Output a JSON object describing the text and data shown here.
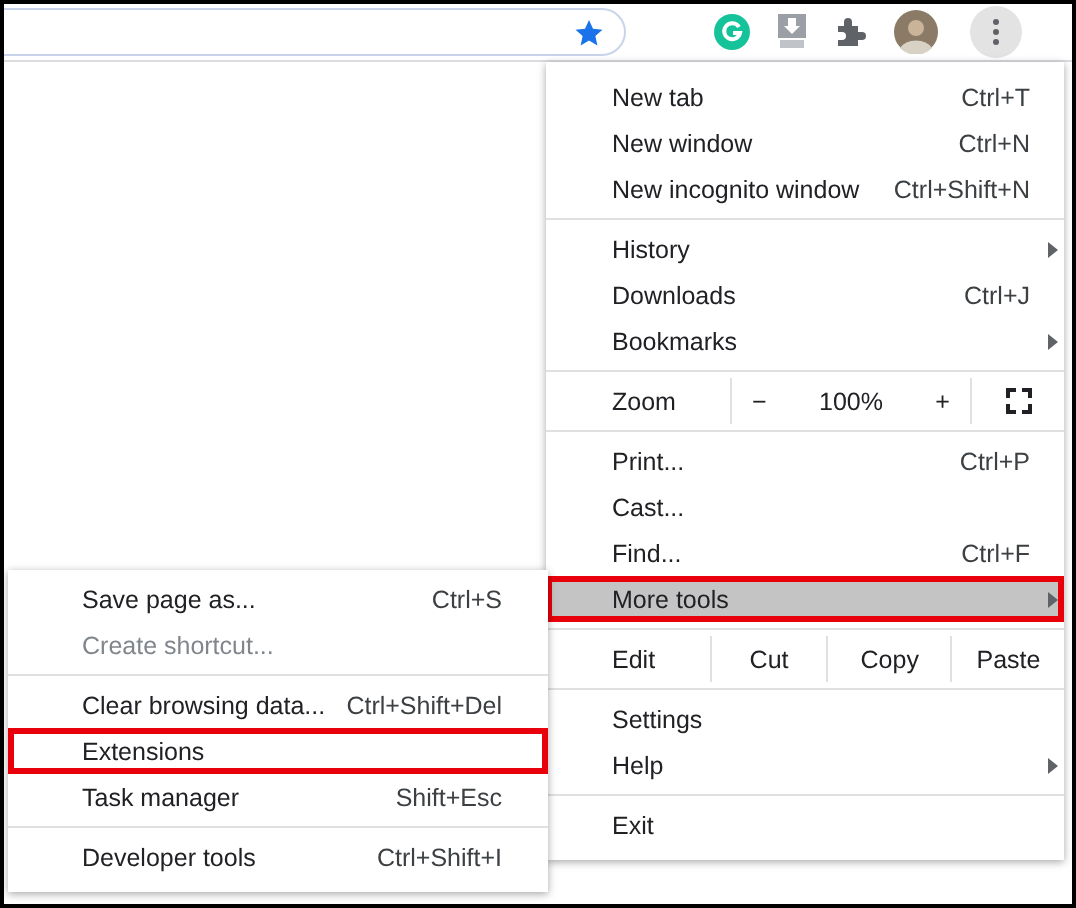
{
  "menu": {
    "items": [
      {
        "kind": "item",
        "label": "New tab",
        "shortcut": "Ctrl+T"
      },
      {
        "kind": "item",
        "label": "New window",
        "shortcut": "Ctrl+N"
      },
      {
        "kind": "item",
        "label": "New incognito window",
        "shortcut": "Ctrl+Shift+N"
      },
      {
        "kind": "separator"
      },
      {
        "kind": "item",
        "label": "History",
        "has_submenu": true
      },
      {
        "kind": "item",
        "label": "Downloads",
        "shortcut": "Ctrl+J"
      },
      {
        "kind": "item",
        "label": "Bookmarks",
        "has_submenu": true
      },
      {
        "kind": "separator"
      },
      {
        "kind": "zoom",
        "label": "Zoom",
        "minus": "−",
        "value": "100%",
        "plus": "+"
      },
      {
        "kind": "separator"
      },
      {
        "kind": "item",
        "label": "Print...",
        "shortcut": "Ctrl+P"
      },
      {
        "kind": "item",
        "label": "Cast..."
      },
      {
        "kind": "item",
        "label": "Find...",
        "shortcut": "Ctrl+F"
      },
      {
        "kind": "item",
        "label": "More tools",
        "has_submenu": true,
        "selected": true,
        "marked": true
      },
      {
        "kind": "separator"
      },
      {
        "kind": "edit",
        "label": "Edit",
        "actions": [
          "Cut",
          "Copy",
          "Paste"
        ]
      },
      {
        "kind": "separator"
      },
      {
        "kind": "item",
        "label": "Settings"
      },
      {
        "kind": "item",
        "label": "Help",
        "has_submenu": true
      },
      {
        "kind": "separator"
      },
      {
        "kind": "item",
        "label": "Exit"
      }
    ]
  },
  "submenu": {
    "items": [
      {
        "kind": "item",
        "label": "Save page as...",
        "shortcut": "Ctrl+S"
      },
      {
        "kind": "item",
        "label": "Create shortcut...",
        "disabled": true
      },
      {
        "kind": "separator"
      },
      {
        "kind": "item",
        "label": "Clear browsing data...",
        "shortcut": "Ctrl+Shift+Del"
      },
      {
        "kind": "item",
        "label": "Extensions",
        "marked": true
      },
      {
        "kind": "item",
        "label": "Task manager",
        "shortcut": "Shift+Esc"
      },
      {
        "kind": "separator"
      },
      {
        "kind": "item",
        "label": "Developer tools",
        "shortcut": "Ctrl+Shift+I"
      }
    ]
  }
}
